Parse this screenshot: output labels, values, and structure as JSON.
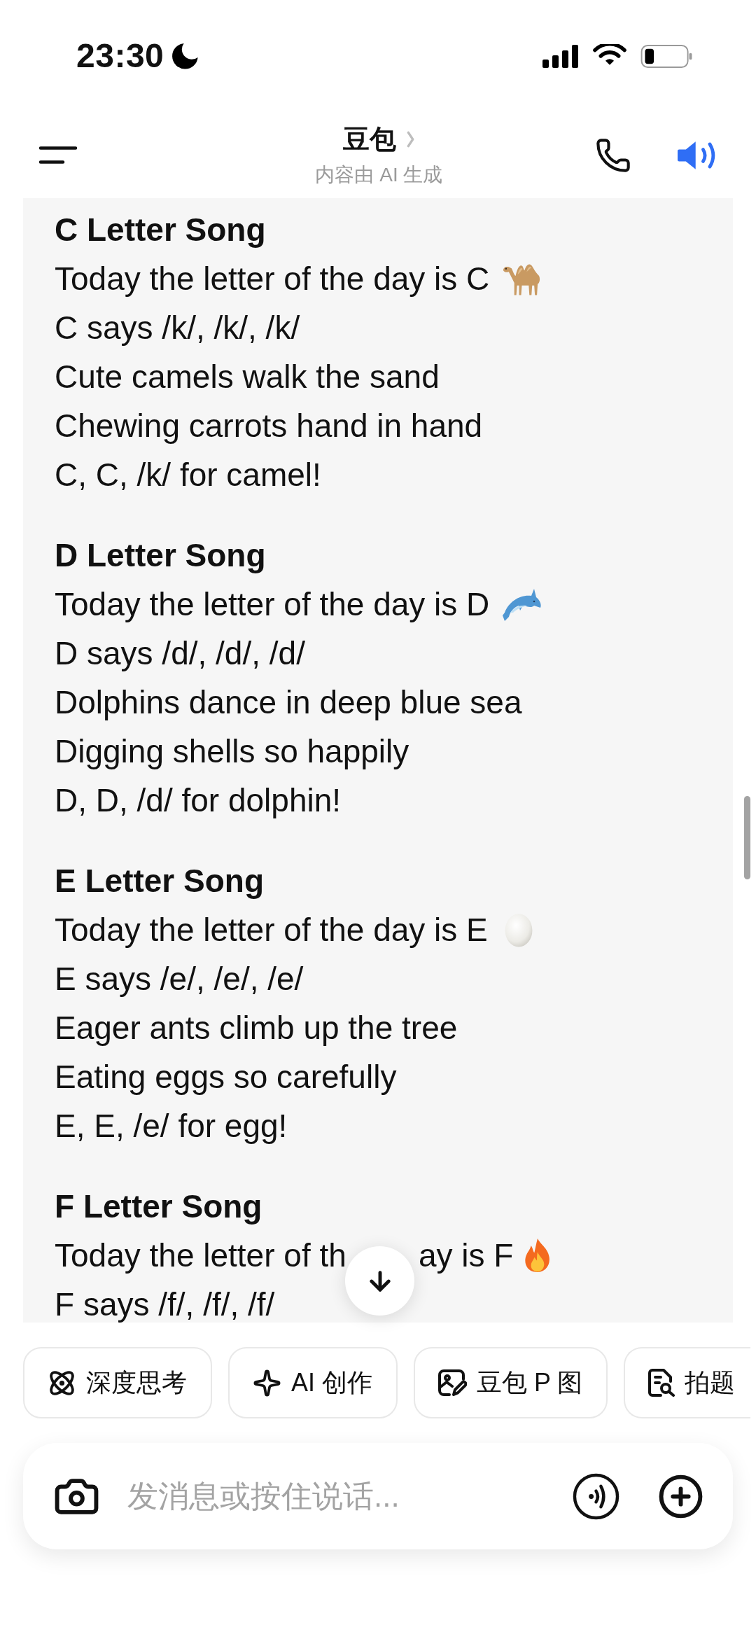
{
  "status_bar": {
    "time": "23:30"
  },
  "header": {
    "title": "豆包",
    "subtitle": "内容由 AI 生成"
  },
  "songs": [
    {
      "kind": "camel",
      "title": "C Letter Song",
      "lines": [
        "Today the letter of the day is C",
        "C says /k/, /k/, /k/",
        "Cute camels walk the sand",
        "Chewing carrots hand in hand",
        "C, C, /k/ for camel!"
      ]
    },
    {
      "kind": "dolphin",
      "title": "D Letter Song",
      "lines": [
        "Today the letter of the day is D",
        "D says /d/, /d/, /d/",
        "Dolphins dance in deep blue sea",
        "Digging shells so happily",
        "D, D, /d/ for dolphin!"
      ]
    },
    {
      "kind": "egg",
      "title": "E Letter Song",
      "lines": [
        "Today the letter of the day is E",
        "E says /e/, /e/, /e/",
        "Eager ants climb up the tree",
        "Eating eggs so carefully",
        "E, E, /e/ for egg!"
      ]
    },
    {
      "kind": "fire",
      "title": "F Letter Song",
      "lines": [
        {
          "left_of_button": "Today the letter of th",
          "right_of_button": "ay is F"
        },
        "F says /f/, /f/, /f/"
      ]
    }
  ],
  "quick_actions": [
    {
      "kind": "think",
      "label": "深度思考"
    },
    {
      "kind": "create",
      "label": "AI 创作"
    },
    {
      "kind": "image",
      "label": "豆包 P 图"
    },
    {
      "kind": "scan",
      "label": "拍题"
    }
  ],
  "composer": {
    "placeholder": "发消息或按住说话..."
  }
}
